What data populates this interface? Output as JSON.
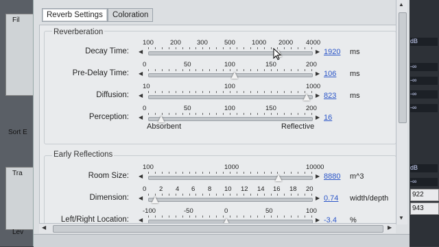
{
  "background_left": {
    "labels": [
      "Fil",
      "Sort E",
      "Tra",
      "Lev"
    ]
  },
  "background_right": {
    "meter_labels": [
      "dB",
      "-∞",
      "-∞",
      "-∞",
      "-∞",
      "dB",
      "-∞"
    ],
    "numbers": [
      "922",
      "943"
    ]
  },
  "tabs": [
    {
      "label": "Reverb Settings",
      "active": true
    },
    {
      "label": "Coloration",
      "active": false
    }
  ],
  "reverberation": {
    "title": "Reverberation",
    "rows": [
      {
        "label": "Decay Time:",
        "scale": [
          "100",
          "200",
          "300",
          "500",
          "1000",
          "2000",
          "4000"
        ],
        "value": "1920",
        "unit": "ms",
        "level": 0.8
      },
      {
        "label": "Pre-Delay Time:",
        "scale": [
          "0",
          "50",
          "100",
          "150",
          "200"
        ],
        "value": "106",
        "unit": "ms",
        "level": 0.53
      },
      {
        "label": "Diffusion:",
        "scale": [
          "10",
          "100",
          "1000"
        ],
        "value": "823",
        "unit": "ms",
        "level": 0.97
      },
      {
        "label": "Perception:",
        "scale": [
          "0",
          "50",
          "100",
          "150",
          "200"
        ],
        "value": "16",
        "unit": "",
        "level": 0.08
      }
    ],
    "captions": {
      "left": "Absorbent",
      "right": "Reflective"
    }
  },
  "early_reflections": {
    "title": "Early Reflections",
    "rows": [
      {
        "label": "Room Size:",
        "scale": [
          "100",
          "1000",
          "10000"
        ],
        "value": "8880",
        "unit": "m^3",
        "level": 0.8
      },
      {
        "label": "Dimension:",
        "scale": [
          "0",
          "2",
          "4",
          "6",
          "8",
          "10",
          "12",
          "14",
          "16",
          "18",
          "20"
        ],
        "value": "0.74",
        "unit": "width/depth",
        "level": 0.04
      },
      {
        "label": "Left/Right Location:",
        "scale": [
          "-100",
          "-50",
          "0",
          "50",
          "100"
        ],
        "value": "-3.4",
        "unit": "%",
        "level": 0.48
      }
    ]
  }
}
